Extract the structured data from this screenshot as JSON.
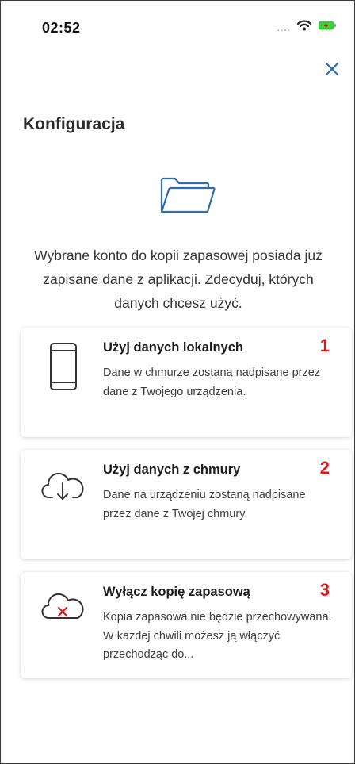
{
  "status_bar": {
    "time": "02:52",
    "signal_dots": "....",
    "icons": [
      "wifi-icon",
      "battery-charging-icon"
    ]
  },
  "header": {
    "close_icon": "close-icon",
    "title": "Konfiguracja"
  },
  "illustration": {
    "icon": "folder-icon"
  },
  "description": "Wybrane konto do kopii zapasowej posiada już zapisane dane z aplikacji. Zdecyduj, których danych chcesz użyć.",
  "options": [
    {
      "icon": "phone-icon",
      "title": "Użyj danych lokalnych",
      "description": "Dane w chmurze zostaną nadpisane przez dane z Twojego urządzenia.",
      "number": "1"
    },
    {
      "icon": "cloud-download-icon",
      "title": "Użyj danych z chmury",
      "description": "Dane na urządzeniu zostaną nadpisane przez dane z Twojej chmury.",
      "number": "2"
    },
    {
      "icon": "cloud-off-icon",
      "title": "Wyłącz kopię zapasową",
      "description": "Kopia zapasowa nie będzie przechowywana. W każdej chwili możesz ją włączyć przechodząc do...",
      "number": "3"
    }
  ],
  "colors": {
    "accent": "#2f6fa7",
    "annotation_red": "#e0161b",
    "battery_green": "#3ccf3c",
    "battery_bolt": "#c8171f"
  }
}
